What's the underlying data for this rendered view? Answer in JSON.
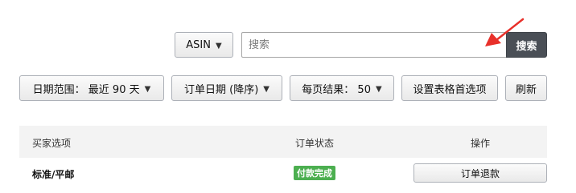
{
  "search_bar": {
    "category_label": "ASIN",
    "input_placeholder": "搜索",
    "input_value": "",
    "search_button_label": "搜索"
  },
  "filters": {
    "date_range_label": "日期范围： 最近 90 天",
    "sort_label": "订单日期 (降序)",
    "per_page_label": "每页结果： 50",
    "table_settings_label": "设置表格首选项",
    "refresh_label": "刷新"
  },
  "table": {
    "headers": [
      "买家选项",
      "订单状态",
      "操作"
    ],
    "rows": [
      {
        "buyer_option": "标准/平邮",
        "status": "付款完成",
        "action_label": "订单退款"
      }
    ]
  },
  "colors": {
    "search_button_bg": "#4a4f56",
    "status_badge_bg": "#4caf50",
    "annotation_arrow": "#e8302a",
    "table_header_bg": "#f3f3f3"
  },
  "icons": {
    "dropdown": "chevron-down-icon",
    "annotation": "red-arrow-annotation"
  }
}
